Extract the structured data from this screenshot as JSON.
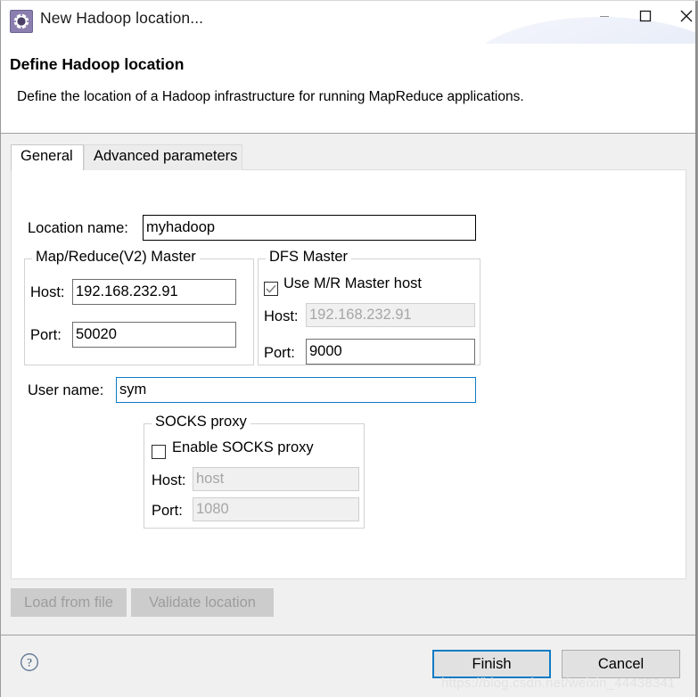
{
  "window": {
    "title": "New Hadoop location...",
    "icon": "hadoop-gear-icon",
    "controls": {
      "minimize": "minimize-icon",
      "maximize": "maximize-icon",
      "close": "close-icon"
    }
  },
  "header": {
    "title": "Define Hadoop location",
    "description": "Define the location of a Hadoop infrastructure for running MapReduce applications."
  },
  "tabs": [
    {
      "label": "General",
      "active": true
    },
    {
      "label": "Advanced parameters",
      "active": false
    }
  ],
  "general": {
    "location_name": {
      "label": "Location name:",
      "value": "myhadoop",
      "placeholder": ""
    },
    "mr_master": {
      "title": "Map/Reduce(V2) Master",
      "host_label": "Host:",
      "host_value": "192.168.232.91",
      "port_label": "Port:",
      "port_value": "50020"
    },
    "dfs_master": {
      "title": "DFS Master",
      "use_mr_host_label": "Use M/R Master host",
      "use_mr_host_checked": true,
      "host_label": "Host:",
      "host_value": "192.168.232.91",
      "host_disabled": true,
      "port_label": "Port:",
      "port_value": "9000"
    },
    "user_name": {
      "label": "User name:",
      "value": "sym"
    },
    "socks_proxy": {
      "title": "SOCKS proxy",
      "enable_label": "Enable SOCKS proxy",
      "enabled": false,
      "host_label": "Host:",
      "host_value": "host",
      "host_disabled": true,
      "port_label": "Port:",
      "port_value": "1080",
      "port_disabled": true
    },
    "actions": {
      "load_from_file": "Load from file",
      "validate_location": "Validate location"
    }
  },
  "footer": {
    "help": "help-icon",
    "finish": "Finish",
    "cancel": "Cancel"
  },
  "watermark": "https://blog.csdn.net/weixin_44438341",
  "colors": {
    "accent": "#0f7bc4",
    "icon_purple": "#8a7fae",
    "disabled_text": "#a6a6a6",
    "panel_bg": "#f0f0f0"
  }
}
